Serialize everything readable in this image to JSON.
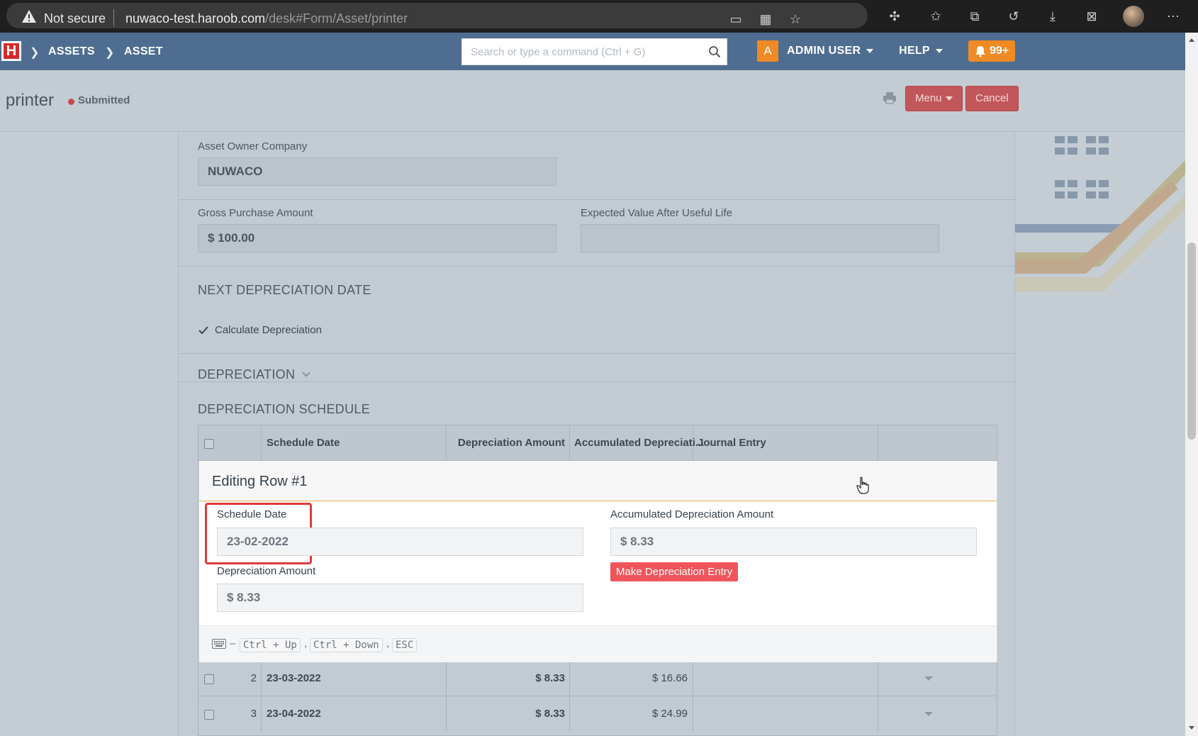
{
  "browser": {
    "security_label": "Not secure",
    "url_host": "nuwaco-test.haroob.com",
    "url_path": "/desk#Form/Asset/printer"
  },
  "navbar": {
    "logo_letter": "H",
    "breadcrumbs": [
      "ASSETS",
      "ASSET"
    ],
    "search_placeholder": "Search or type a command (Ctrl + G)",
    "user_initial": "A",
    "user_name": "ADMIN USER",
    "help_label": "HELP",
    "notifications": "99+"
  },
  "page": {
    "title": "printer",
    "status": "Submitted",
    "menu_label": "Menu",
    "cancel_label": "Cancel"
  },
  "form": {
    "asset_owner_company_label": "Asset Owner Company",
    "asset_owner_company": "NUWACO",
    "gross_purchase_amount_label": "Gross Purchase Amount",
    "gross_purchase_amount": "$ 100.00",
    "expected_value_label": "Expected Value After Useful Life",
    "expected_value": "",
    "next_depreciation_section": "NEXT DEPRECIATION DATE",
    "calculate_depreciation_label": "Calculate Depreciation",
    "depreciation_section": "DEPRECIATION",
    "schedule_section": "DEPRECIATION SCHEDULE"
  },
  "grid": {
    "columns": [
      "Schedule Date",
      "Depreciation Amount",
      "Accumulated Depreciati...",
      "Journal Entry"
    ],
    "rows": [
      {
        "idx": "2",
        "date": "23-03-2022",
        "amount": "$ 8.33",
        "accumulated": "$ 16.66",
        "journal": ""
      },
      {
        "idx": "3",
        "date": "23-04-2022",
        "amount": "$ 8.33",
        "accumulated": "$ 24.99",
        "journal": ""
      }
    ]
  },
  "editing_row": {
    "title": "Editing Row #1",
    "schedule_date_label": "Schedule Date",
    "schedule_date": "23-02-2022",
    "depreciation_amount_label": "Depreciation Amount",
    "depreciation_amount": "$ 8.33",
    "accumulated_label": "Accumulated Depreciation Amount",
    "accumulated": "$ 8.33",
    "make_entry_label": "Make Depreciation Entry",
    "shortcuts": [
      "Ctrl + Up",
      "Ctrl + Down",
      "ESC"
    ],
    "shortcut_prefix": "–",
    "shortcut_separator": ","
  },
  "colors": {
    "navbar": "#4e6d91",
    "accent_orange": "#f08a24",
    "danger": "#f0555b",
    "highlight": "#e0393e"
  }
}
